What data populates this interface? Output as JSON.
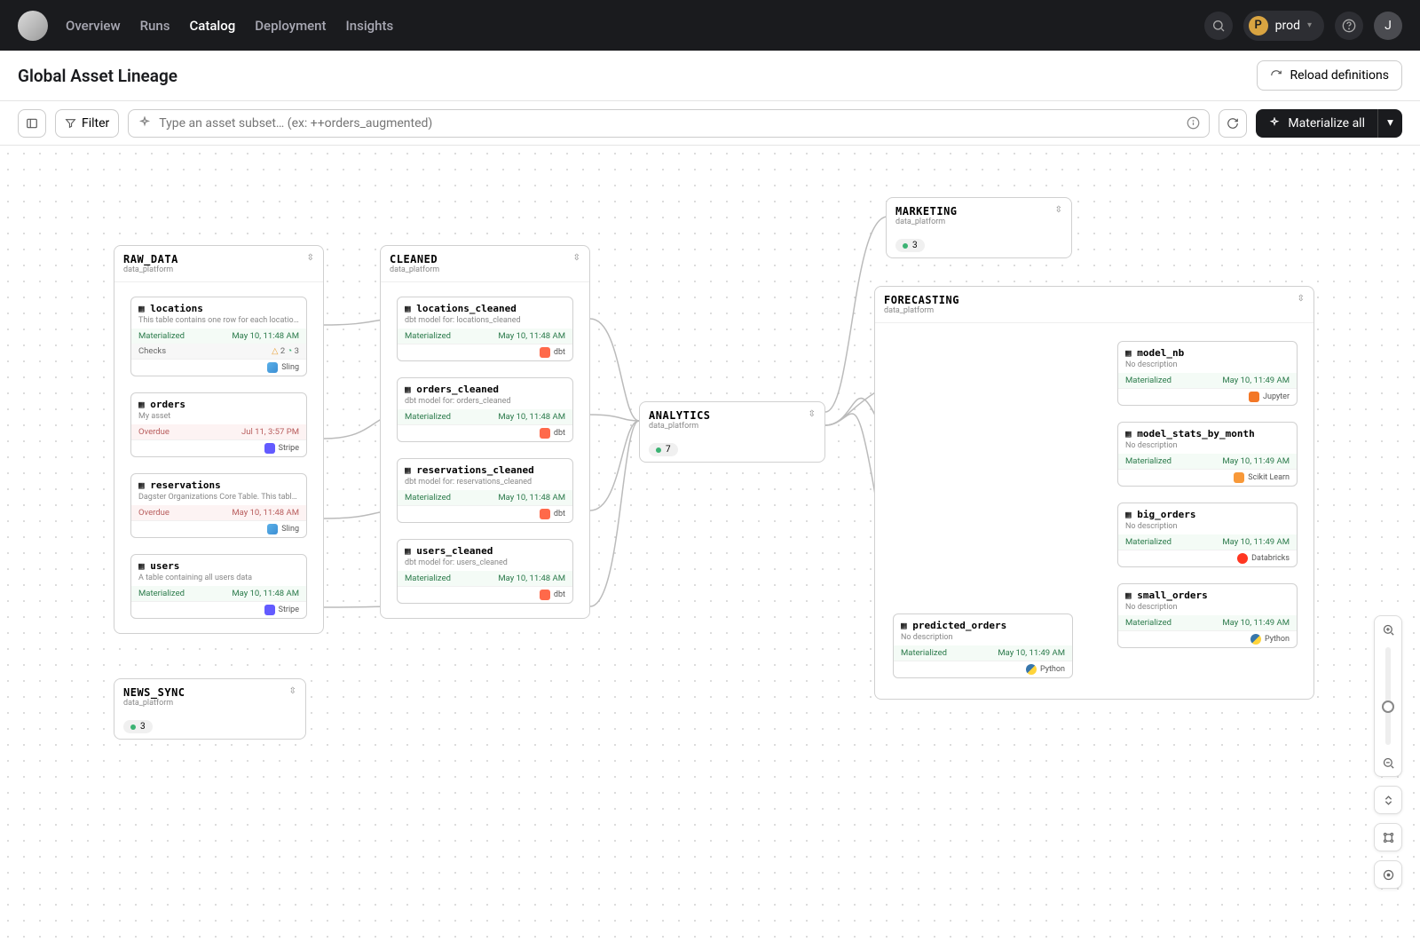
{
  "nav": {
    "items": [
      "Overview",
      "Runs",
      "Catalog",
      "Deployment",
      "Insights"
    ],
    "active": "Catalog",
    "env_letter": "P",
    "env_name": "prod",
    "avatar": "J"
  },
  "page": {
    "title": "Global Asset Lineage",
    "reload": "Reload definitions",
    "filter": "Filter",
    "search_placeholder": "Type an asset subset… (ex: ++orders_augmented)",
    "materialize": "Materialize all"
  },
  "groups": {
    "raw": {
      "name": "RAW_DATA",
      "sub": "data_platform",
      "assets": [
        {
          "name": "locations",
          "desc": "This table contains one row for each location.",
          "status": "Materialized",
          "time": "May 10, 11:48 AM",
          "checks": "Checks",
          "check_warn": "2",
          "check_ok": "3",
          "tag": "Sling",
          "tag_ic": "ic-sling"
        },
        {
          "name": "orders",
          "desc": "My asset",
          "status": "Overdue",
          "time": "Jul 11, 3:57 PM",
          "tag": "Stripe",
          "tag_ic": "ic-stripe",
          "over": true
        },
        {
          "name": "reservations",
          "desc": "Dagster Organizations Core Table. This table con…",
          "status": "Overdue",
          "time": "May 10, 11:48 AM",
          "tag": "Sling",
          "tag_ic": "ic-sling",
          "over": true
        },
        {
          "name": "users",
          "desc": "A table containing all users data",
          "status": "Materialized",
          "time": "May 10, 11:48 AM",
          "tag": "Stripe",
          "tag_ic": "ic-stripe"
        }
      ]
    },
    "cleaned": {
      "name": "CLEANED",
      "sub": "data_platform",
      "assets": [
        {
          "name": "locations_cleaned",
          "desc": "dbt model for: locations_cleaned",
          "status": "Materialized",
          "time": "May 10, 11:48 AM",
          "tag": "dbt",
          "tag_ic": "ic-dbt"
        },
        {
          "name": "orders_cleaned",
          "desc": "dbt model for: orders_cleaned",
          "status": "Materialized",
          "time": "May 10, 11:48 AM",
          "tag": "dbt",
          "tag_ic": "ic-dbt"
        },
        {
          "name": "reservations_cleaned",
          "desc": "dbt model for: reservations_cleaned",
          "status": "Materialized",
          "time": "May 10, 11:48 AM",
          "tag": "dbt",
          "tag_ic": "ic-dbt"
        },
        {
          "name": "users_cleaned",
          "desc": "dbt model for: users_cleaned",
          "status": "Materialized",
          "time": "May 10, 11:48 AM",
          "tag": "dbt",
          "tag_ic": "ic-dbt"
        }
      ]
    },
    "analytics": {
      "name": "ANALYTICS",
      "sub": "data_platform",
      "count": "7"
    },
    "marketing": {
      "name": "MARKETING",
      "sub": "data_platform",
      "count": "3"
    },
    "news": {
      "name": "NEWS_SYNC",
      "sub": "data_platform",
      "count": "3"
    },
    "forecast": {
      "name": "FORECASTING",
      "sub": "data_platform",
      "pred": {
        "name": "predicted_orders",
        "desc": "No description",
        "status": "Materialized",
        "time": "May 10, 11:49 AM",
        "tag": "Python",
        "tag_ic": "ic-py"
      },
      "right": [
        {
          "name": "model_nb",
          "desc": "No description",
          "status": "Materialized",
          "time": "May 10, 11:49 AM",
          "tag": "Jupyter",
          "tag_ic": "ic-jup"
        },
        {
          "name": "model_stats_by_month",
          "desc": "No description",
          "status": "Materialized",
          "time": "May 10, 11:49 AM",
          "tag": "Scikit Learn",
          "tag_ic": "ic-sk"
        },
        {
          "name": "big_orders",
          "desc": "No description",
          "status": "Materialized",
          "time": "May 10, 11:49 AM",
          "tag": "Databricks",
          "tag_ic": "ic-db"
        },
        {
          "name": "small_orders",
          "desc": "No description",
          "status": "Materialized",
          "time": "May 10, 11:49 AM",
          "tag": "Python",
          "tag_ic": "ic-py"
        }
      ]
    }
  }
}
